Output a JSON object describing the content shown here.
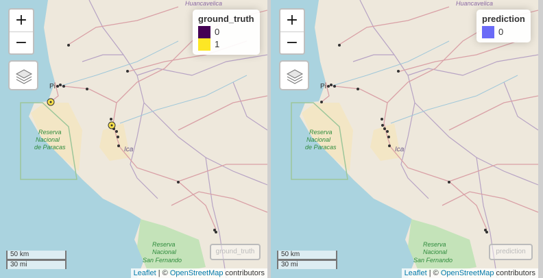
{
  "panels": [
    {
      "id": "ground_truth",
      "legend": {
        "title": "ground_truth",
        "items": [
          {
            "label": "0",
            "color": "#440154"
          },
          {
            "label": "1",
            "color": "#fde725"
          }
        ]
      },
      "layer_badge": "ground_truth"
    },
    {
      "id": "prediction",
      "legend": {
        "title": "prediction",
        "items": [
          {
            "label": "0",
            "color": "#6a6af7"
          }
        ]
      },
      "layer_badge": "prediction"
    }
  ],
  "zoom": {
    "in": "+",
    "out": "−"
  },
  "scale": {
    "km": "50 km",
    "mi": "30 mi"
  },
  "attribution": {
    "leaflet": "Leaflet",
    "sep": " | © ",
    "osm": "OpenStreetMap",
    "suffix": " contributors"
  },
  "map_labels": {
    "reserve_paracas_1": "Reserva",
    "reserve_paracas_2": "Nacional",
    "reserve_paracas_3": "de Paracas",
    "reserve_sf_1": "Reserva",
    "reserve_sf_2": "Nacional",
    "reserve_sf_3": "San Fernando",
    "ica": "Ica",
    "pisco": "Pi",
    "huancavelica": "Huancavelica"
  },
  "colors": {
    "sea": "#aad3df",
    "land": "#f1ede4",
    "desert": "#f3e6c5",
    "reserve": "#a5d39b",
    "road": "#d9a0a6",
    "border": "#a58bb3"
  }
}
